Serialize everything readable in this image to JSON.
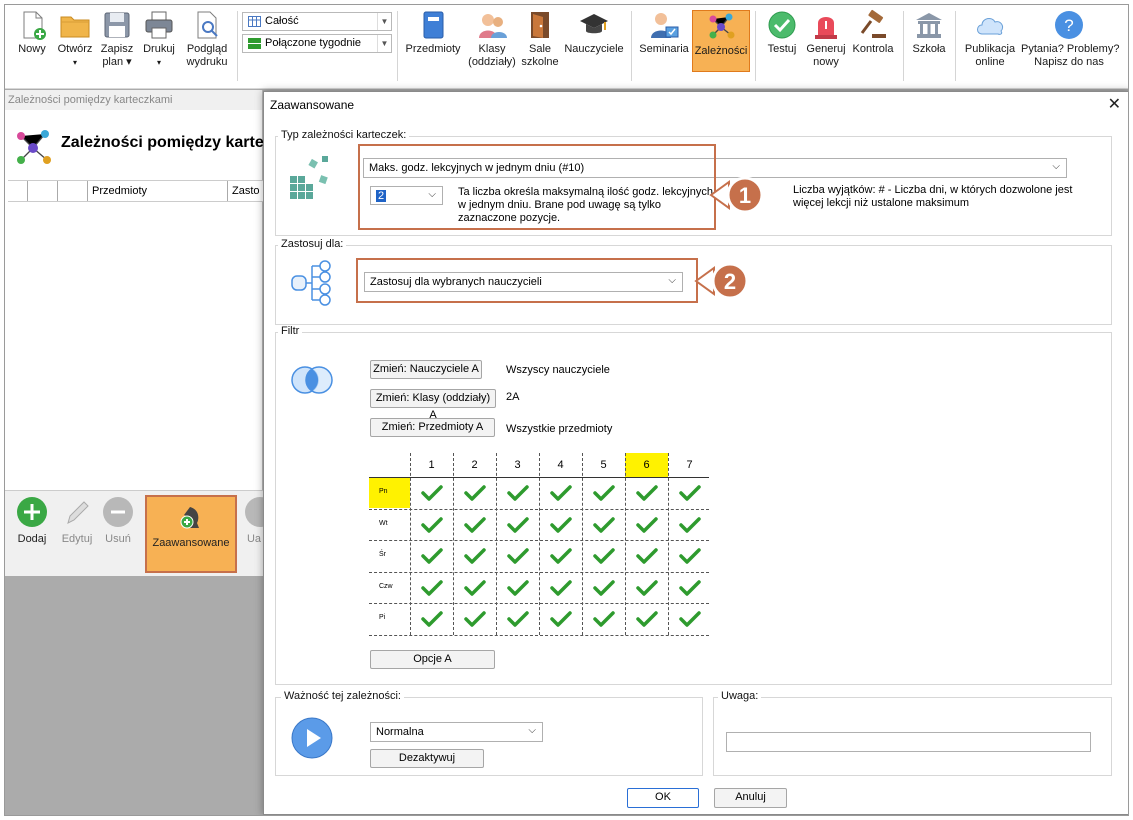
{
  "ribbon": {
    "items": [
      {
        "label": "Nowy",
        "icon": "new-file-icon"
      },
      {
        "label": "Otwórz",
        "icon": "folder-icon"
      },
      {
        "label": "Zapisz",
        "label2": "plan",
        "icon": "save-icon"
      },
      {
        "label": "Drukuj",
        "icon": "printer-icon"
      },
      {
        "label": "Podgląd",
        "label2": "wydruku",
        "icon": "print-preview-icon"
      },
      {
        "label": "Przedmioty",
        "icon": "book-icon"
      },
      {
        "label": "Klasy",
        "label2": "(oddziały)",
        "icon": "students-icon"
      },
      {
        "label": "Sale",
        "label2": "szkolne",
        "icon": "door-icon"
      },
      {
        "label": "Nauczyciele",
        "icon": "graduation-cap-icon"
      },
      {
        "label": "Seminaria",
        "icon": "seminar-icon"
      },
      {
        "label": "Zależności",
        "icon": "network-icon"
      },
      {
        "label": "Testuj",
        "icon": "check-badge-icon"
      },
      {
        "label": "Generuj",
        "label2": "nowy",
        "icon": "siren-icon"
      },
      {
        "label": "Kontrola",
        "icon": "gavel-icon"
      },
      {
        "label": "Szkoła",
        "icon": "building-icon"
      },
      {
        "label": "Publikacja",
        "label2": "online",
        "icon": "cloud-icon"
      },
      {
        "label": "Pytania? Problemy?",
        "label2": "Napisz do nas",
        "icon": "question-icon"
      }
    ],
    "combo_view": "Całość",
    "combo_weeks": "Połączone tygodnie"
  },
  "bg_window": {
    "title": "Zależności pomiędzy karteczkami",
    "heading": "Zależności pomiędzy karte",
    "col_przedmioty": "Przedmioty",
    "col_zasto": "Zasto",
    "tools": {
      "add": "Dodaj",
      "edit": "Edytuj",
      "remove": "Usuń",
      "advanced": "Zaawansowane",
      "partial": "Ua"
    }
  },
  "dialog": {
    "title": "Zaawansowane",
    "type_group": "Typ zależności karteczek:",
    "type_value": "Maks. godz. lekcyjnych w jednym dniu (#10)",
    "hours_value": "2",
    "hours_desc": "Ta liczba określa maksymalną ilość godz. lekcyjnych w jednym dniu. Brane pod uwagę są tylko zaznaczone pozycje.",
    "exceptions_desc": "Liczba wyjątków: # - Liczba dni, w których dozwolone jest więcej lekcji niż ustalone maksimum",
    "apply_group": "Zastosuj dla:",
    "apply_value": "Zastosuj dla wybranych nauczycieli",
    "filter_group": "Filtr",
    "btn_teachers": "Zmień: Nauczyciele A",
    "val_teachers": "Wszyscy nauczyciele",
    "btn_classes": "Zmień: Klasy (oddziały) A",
    "val_classes": "2A",
    "btn_subjects": "Zmień: Przedmioty A",
    "val_subjects": "Wszystkie przedmioty",
    "periods": [
      "1",
      "2",
      "3",
      "4",
      "5",
      "6",
      "7"
    ],
    "days": [
      "Pn",
      "Wt",
      "Śr",
      "Czw",
      "Pi"
    ],
    "highlight_period": "6",
    "highlight_day": "Pn",
    "options_btn": "Opcje A",
    "importance_group": "Ważność tej zależności:",
    "importance_value": "Normalna",
    "deactivate_btn": "Dezaktywuj",
    "note_group": "Uwaga:",
    "note_value": "",
    "ok": "OK",
    "cancel": "Anuluj"
  },
  "callouts": [
    "1",
    "2"
  ],
  "colors": {
    "accent_orange": "#f7b154",
    "highlight_yellow": "#fff200",
    "check_green": "#2e9b2e",
    "callout_border": "#c6704b"
  }
}
